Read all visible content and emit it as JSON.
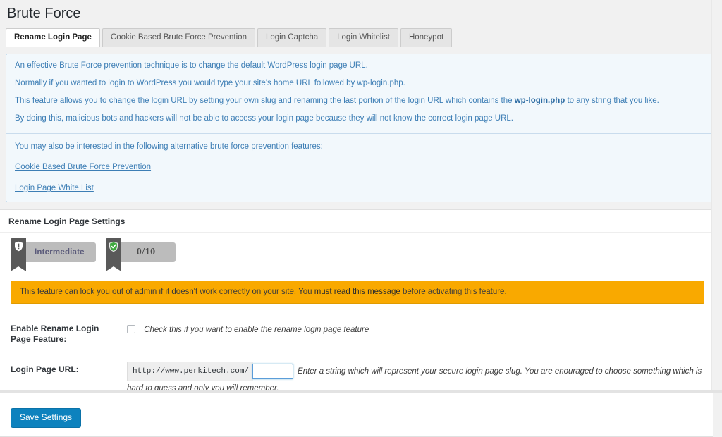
{
  "page": {
    "title": "Brute Force"
  },
  "tabs": [
    {
      "label": "Rename Login Page",
      "active": true
    },
    {
      "label": "Cookie Based Brute Force Prevention",
      "active": false
    },
    {
      "label": "Login Captcha",
      "active": false
    },
    {
      "label": "Login Whitelist",
      "active": false
    },
    {
      "label": "Honeypot",
      "active": false
    }
  ],
  "info": {
    "paragraphs": [
      "An effective Brute Force prevention technique is to change the default WordPress login page URL.",
      "Normally if you wanted to login to WordPress you would type your site's home URL followed by wp-login.php.",
      "By doing this, malicious bots and hackers will not be able to access your login page because they will not know the correct login page URL."
    ],
    "feature_line_prefix": "This feature allows you to change the login URL by setting your own slug and renaming the last portion of the login URL which contains the ",
    "feature_line_bold": "wp-login.php",
    "feature_line_suffix": " to any string that you like.",
    "alt_intro": "You may also be interested in the following alternative brute force prevention features:",
    "links": [
      "Cookie Based Brute Force Prevention",
      "Login Page White List"
    ]
  },
  "settings": {
    "heading": "Rename Login Page Settings",
    "badges": {
      "level_label": "Intermediate",
      "level_icon": "shield-alert-icon",
      "score_label": "0/10",
      "score_icon": "shield-check-icon"
    },
    "warning": {
      "text_before": "This feature can lock you out of admin if it doesn't work correctly on your site. You ",
      "link_text": "must read this message",
      "text_after": " before activating this feature."
    },
    "rows": {
      "enable": {
        "label": "Enable Rename Login Page Feature:",
        "checkbox_checked": false,
        "hint": "Check this if you want to enable the rename login page feature"
      },
      "url": {
        "label": "Login Page URL:",
        "prefix": "http://www.perkitech.com/",
        "value": "",
        "placeholder": "",
        "description": "Enter a string which will represent your secure login page slug. You are enouraged to choose something which is hard to guess and only you will remember."
      }
    },
    "save_label": "Save Settings"
  },
  "colors": {
    "accent_blue": "#0d82be",
    "info_border": "#4b8ec4",
    "info_bg": "#f2f8fc",
    "info_text": "#3d7eb5",
    "warning_bg": "#f9a900",
    "badge_bg": "#bcbcbc",
    "ribbon": "#595959",
    "shield_green": "#3fa93f"
  }
}
